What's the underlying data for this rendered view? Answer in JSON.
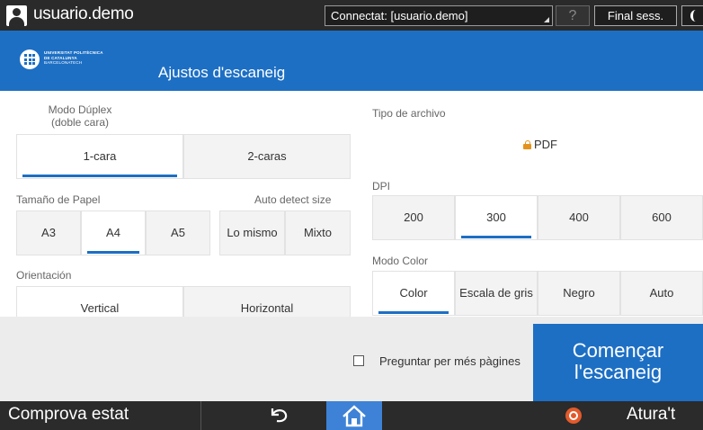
{
  "topbar": {
    "user": "usuario.demo",
    "status": "Connectat: [usuario.demo]",
    "help": "?",
    "end_session": "Final sess."
  },
  "header": {
    "logo_lines": [
      "UNIVERSITAT POLITÈCNICA",
      "DE CATALUNYA",
      "BARCELONATECH"
    ],
    "title": "Ajustos d'escaneig"
  },
  "duplex": {
    "label_line1": "Modo Dúplex",
    "label_line2": "(doble cara)",
    "options": [
      "1-cara",
      "2-caras"
    ],
    "selected": "1-cara"
  },
  "paper": {
    "label": "Tamaño de Papel",
    "auto_label": "Auto detect size",
    "sizes": [
      "A3",
      "A4",
      "A5"
    ],
    "selected": "A4",
    "auto_options": [
      "Lo mismo",
      "Mixto"
    ]
  },
  "orientation": {
    "label": "Orientación",
    "options": [
      "Vertical",
      "Horizontal"
    ]
  },
  "file_type": {
    "label": "Tipo de archivo",
    "value": "PDF"
  },
  "dpi": {
    "label": "DPI",
    "options": [
      "200",
      "300",
      "400",
      "600"
    ],
    "selected": "300"
  },
  "color_mode": {
    "label": "Modo Color",
    "options": [
      "Color",
      "Escala de gris",
      "Negro",
      "Auto"
    ],
    "selected": "Color"
  },
  "actions": {
    "ask_more_pages": "Preguntar per més pàgines",
    "start_line1": "Començar",
    "start_line2": "l'escaneig"
  },
  "bottombar": {
    "status": "Comprova estat",
    "stop": "Atura't"
  },
  "colors": {
    "accent": "#1d6fc4",
    "topbar": "#2a2a2a",
    "lock": "#e3931d",
    "stop": "#e35a2b"
  }
}
